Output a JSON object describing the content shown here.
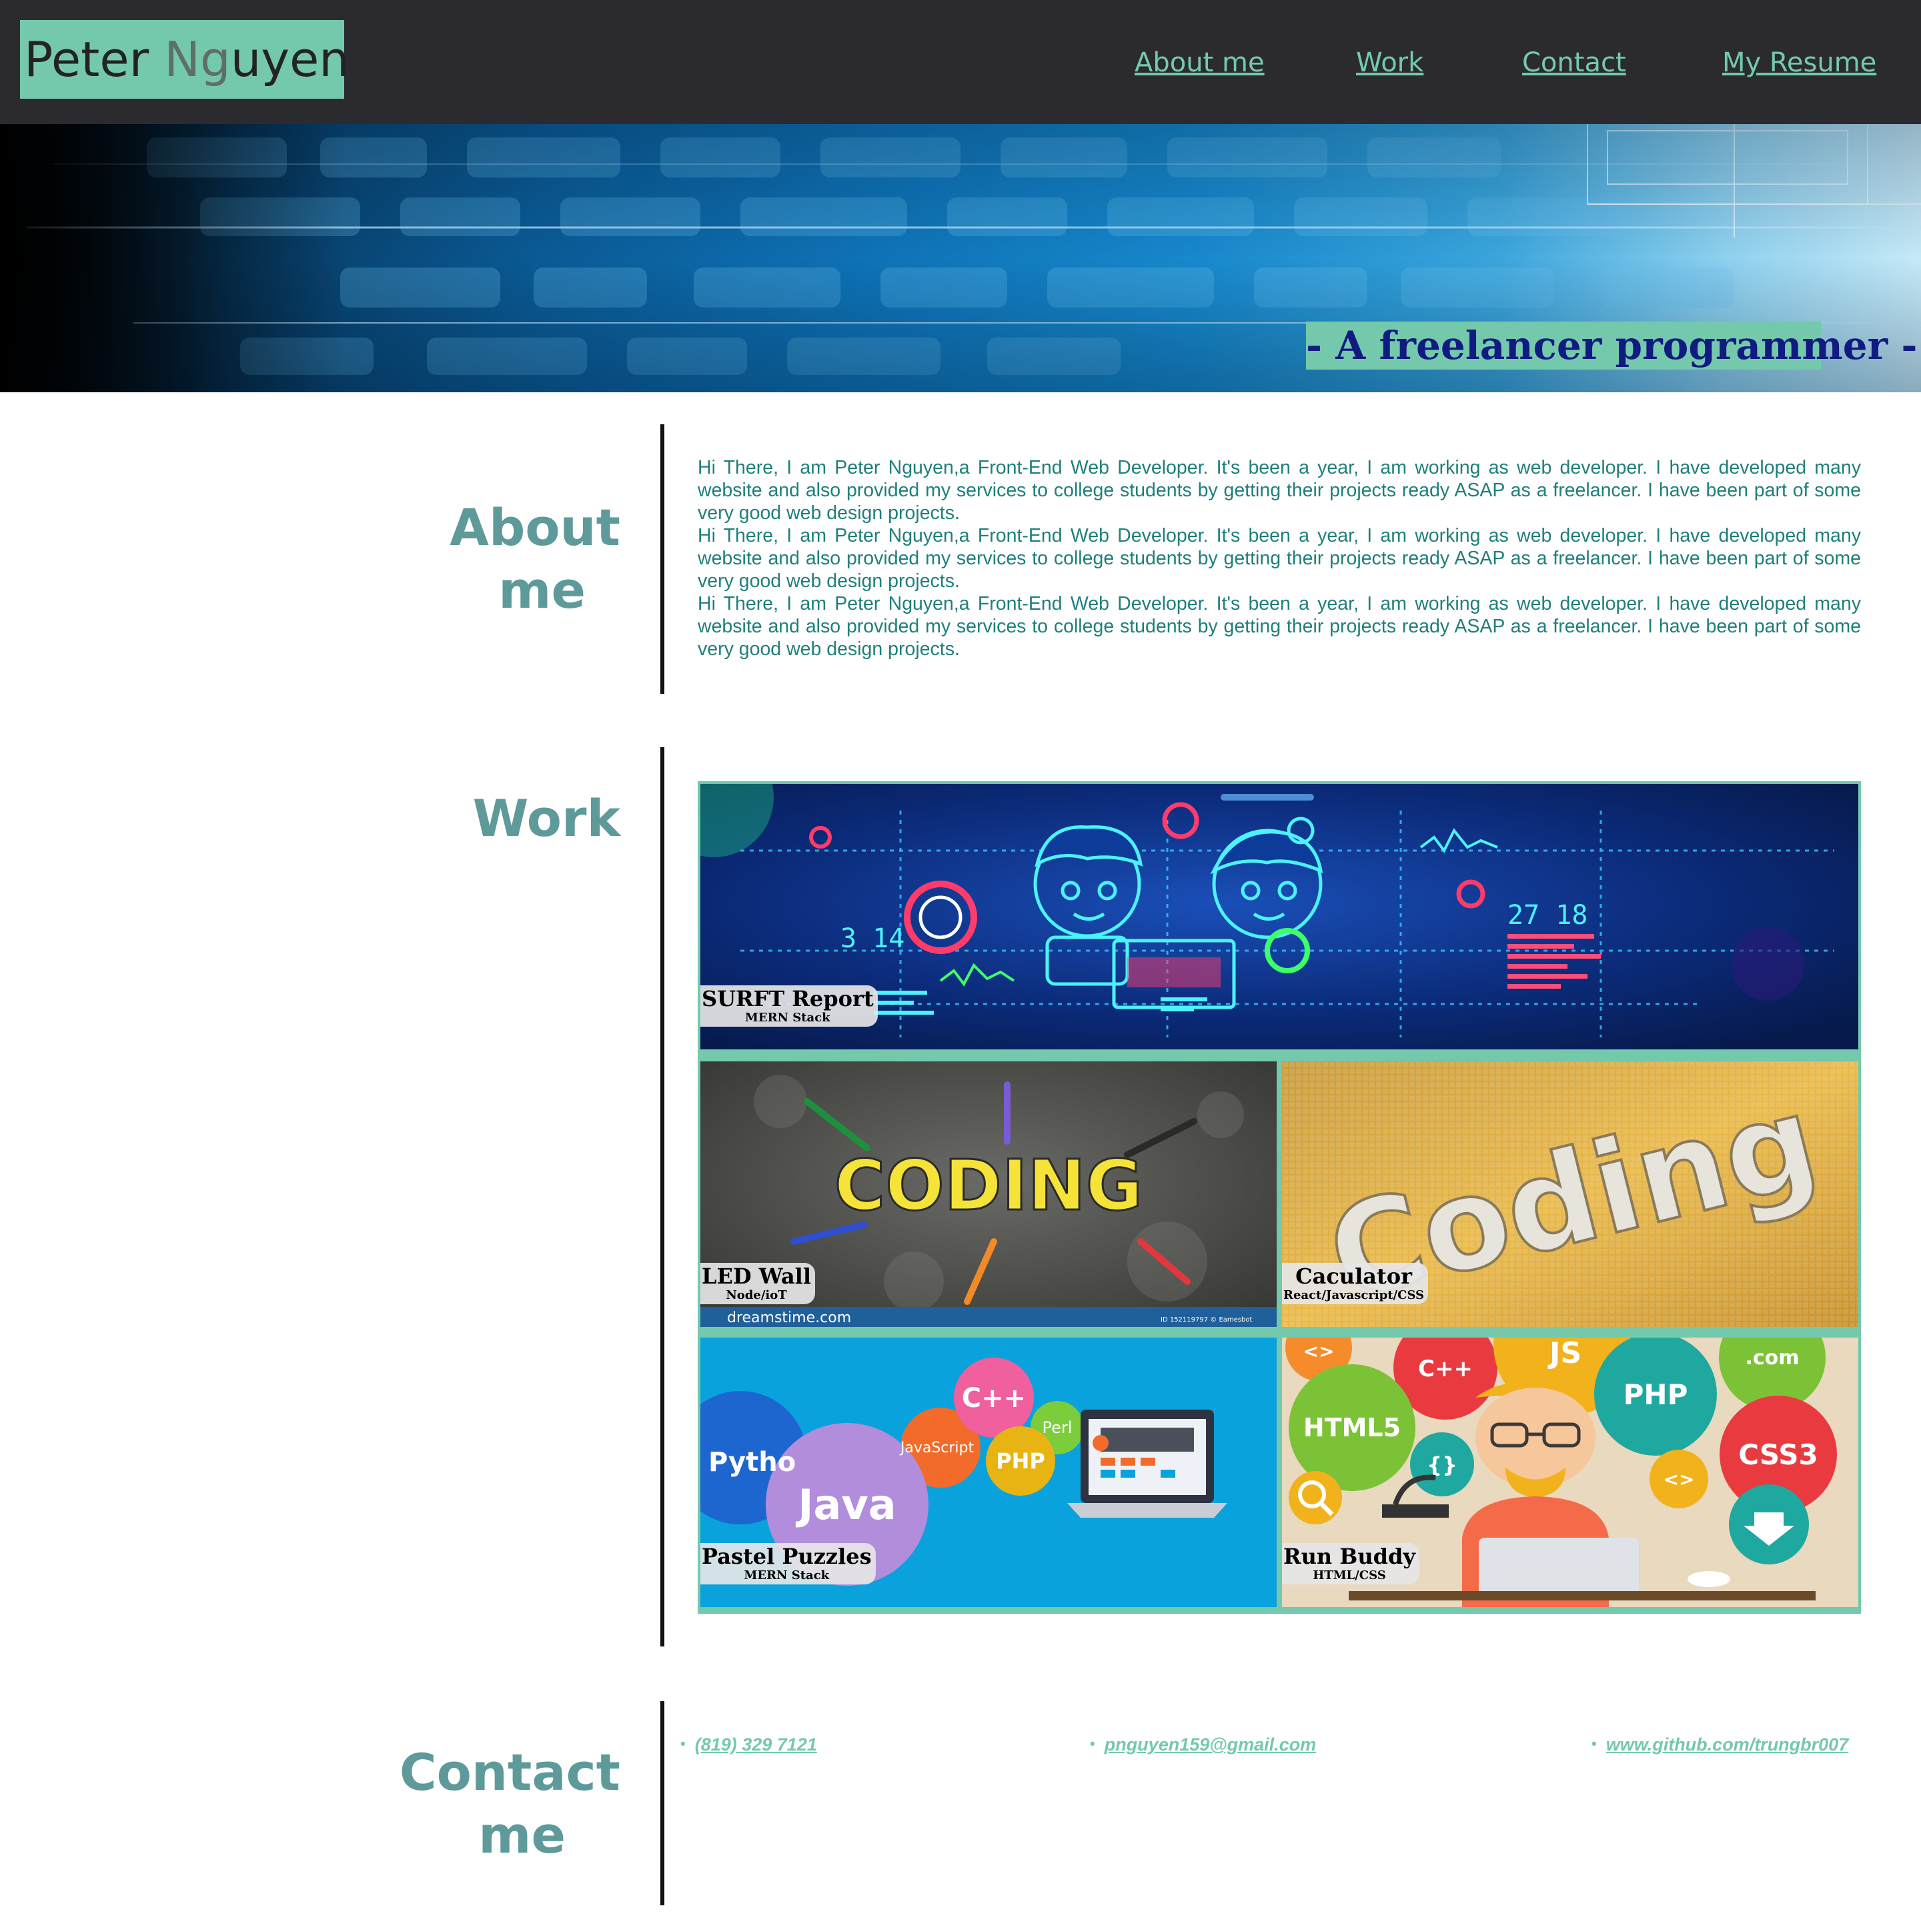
{
  "header": {
    "brand_first": "Peter ",
    "brand_g": "N",
    "brand_g2": "g",
    "brand_rest": "uyen",
    "nav": [
      {
        "label": "About me"
      },
      {
        "label": "Work"
      },
      {
        "label": "Contact"
      },
      {
        "label": "My Resume"
      }
    ]
  },
  "hero": {
    "tagline": "- A freelancer programmer -"
  },
  "about": {
    "title_line1": "About",
    "title_line2": "me",
    "paragraphs": [
      "Hi There, I am Peter Nguyen,a Front-End Web Developer. It's been a year, I am working as web developer. I have developed many website and also provided my services to college students by getting their projects ready ASAP as a freelancer. I have been part of some very good web design projects.",
      "Hi There, I am Peter Nguyen,a Front-End Web Developer. It's been a year, I am working as web developer. I have developed many website and also provided my services to college students by getting their projects ready ASAP as a freelancer. I have been part of some very good web design projects.",
      "Hi There, I am Peter Nguyen,a Front-End Web Developer. It's been a year, I am working as web developer. I have developed many website and also provided my services to college students by getting their projects ready ASAP as a freelancer. I have been part of some very good web design projects."
    ]
  },
  "work": {
    "title": "Work",
    "projects": [
      {
        "title": "SURFT Report",
        "stack": "MERN Stack"
      },
      {
        "title": "LED Wall",
        "stack": "Node/ioT",
        "image_text": "CODING",
        "watermark": "dreamstime.com",
        "watermark_id": "ID 152119797 © Eamesbot"
      },
      {
        "title": "Caculator",
        "stack": "React/Javascript/CSS",
        "image_text": "Coding"
      },
      {
        "title": "Pastel Puzzles",
        "stack": "MERN Stack",
        "bubbles": [
          "Pytho",
          "Java",
          "JavaScript",
          "C++",
          "Perl",
          "PHP"
        ]
      },
      {
        "title": "Run Buddy",
        "stack": "HTML/CSS",
        "bubbles": [
          "<>",
          "JS",
          "C++",
          ".com",
          "PHP",
          "HTML5",
          "{}",
          "CSS3",
          "<>"
        ]
      }
    ],
    "surft_numbers": [
      "3 14",
      "27 18"
    ]
  },
  "contact": {
    "title_line1": "Contact",
    "title_line2": "me",
    "phone": "(819) 329 7121",
    "email": "pnguyen159@gmail.com",
    "github": "www.github.com/trungbr007"
  },
  "colors": {
    "accent": "#74c9ad",
    "header_bg": "#2b2b2f",
    "section_title": "#5f9a9a",
    "body_text": "#1f7f7b",
    "tagline_text": "#101a80"
  }
}
